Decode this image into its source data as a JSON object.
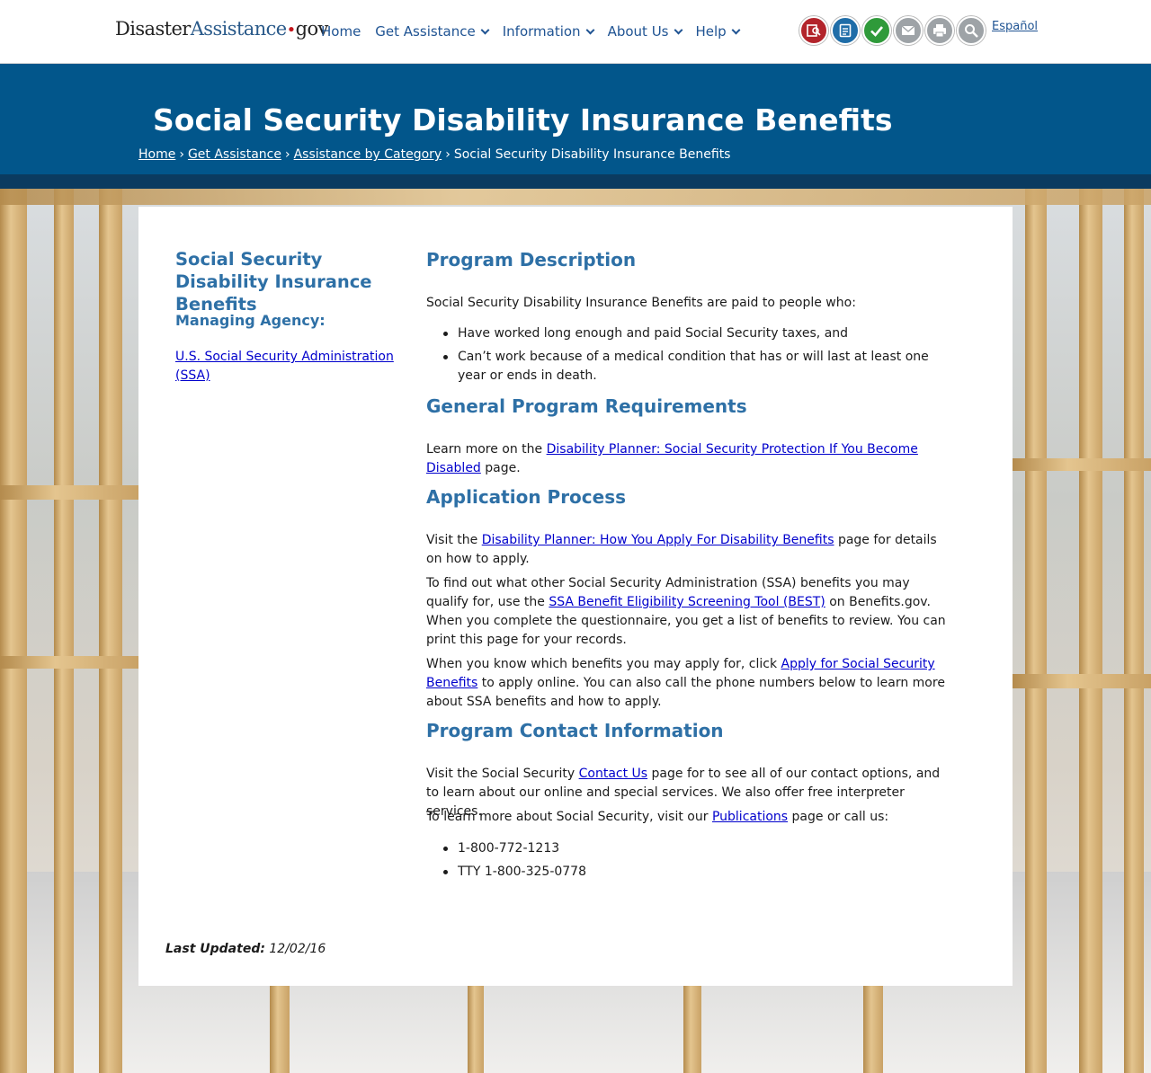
{
  "header": {
    "logo": {
      "part1": "Disaster",
      "part2": "Assistance",
      "dot": "•",
      "part3": "gov"
    },
    "nav": [
      {
        "label": "Home",
        "has_menu": false
      },
      {
        "label": "Get Assistance",
        "has_menu": true
      },
      {
        "label": "Information",
        "has_menu": true
      },
      {
        "label": "About Us",
        "has_menu": true
      },
      {
        "label": "Help",
        "has_menu": true
      }
    ],
    "tools": [
      {
        "icon": "find-assistance-icon",
        "color": "#b3242b"
      },
      {
        "icon": "apply-online-icon",
        "color": "#1f6da8"
      },
      {
        "icon": "check-status-icon",
        "color": "#2f9a3a"
      },
      {
        "icon": "email-icon",
        "color": "#9ea3a7"
      },
      {
        "icon": "print-icon",
        "color": "#9ea3a7"
      },
      {
        "icon": "search-icon",
        "color": "#9ea3a7"
      }
    ],
    "language_link": "Español"
  },
  "banner": {
    "title": "Social Security Disability Insurance Benefits",
    "breadcrumb": {
      "home": "Home",
      "get_assistance": "Get Assistance",
      "category": "Assistance by Category",
      "current": "Social Security Disability Insurance Benefits",
      "separator": "›"
    }
  },
  "sidebar": {
    "title": "Social Security Disability Insurance Benefits",
    "managing_label": "Managing Agency:",
    "agency_link": "U.S. Social Security Administration (SSA)"
  },
  "content": {
    "program_description": {
      "heading": "Program Description",
      "intro": "Social Security Disability Insurance Benefits are paid to people who:",
      "bullets": [
        "Have worked long enough and paid Social Security taxes, and",
        "Can’t work because of a medical condition that has or will last at least one year or ends in death."
      ]
    },
    "requirements": {
      "heading": "General Program Requirements",
      "pre": "Learn more on the ",
      "link": "Disability Planner: Social Security Protection If You Become Disabled",
      "post": " page."
    },
    "application": {
      "heading": "Application Process",
      "p1_pre": "Visit the ",
      "p1_link": "Disability Planner: How You Apply For Disability Benefits",
      "p1_post": " page for details on how to apply.",
      "p2_pre": "To find out what other Social Security Administration (SSA) benefits you may qualify for, use the ",
      "p2_link": "SSA Benefit Eligibility Screening Tool (BEST)",
      "p2_post": " on Benefits.gov. When you complete the questionnaire, you get a list of benefits to review. You can print this page for your records.",
      "p3_pre": "When you know which benefits you may apply for, click ",
      "p3_link": "Apply for Social Security Benefits",
      "p3_post": " to apply online. You can also call the phone numbers below to learn more about SSA benefits and how to apply."
    },
    "contact": {
      "heading": "Program Contact Information",
      "p1_pre": "Visit the Social Security ",
      "p1_link": "Contact Us",
      "p1_post": " page for to see all of our contact options, and to learn about our online and special services. We also offer free interpreter services.",
      "p2_pre": "To learn more about Social Security, visit our ",
      "p2_link": "Publications",
      "p2_post": " page or call us:",
      "phones": [
        "1-800-772-1213",
        "TTY 1-800-325-0778"
      ]
    }
  },
  "footer": {
    "updated_label": "Last Updated:",
    "updated_date": " 12/02/16"
  }
}
